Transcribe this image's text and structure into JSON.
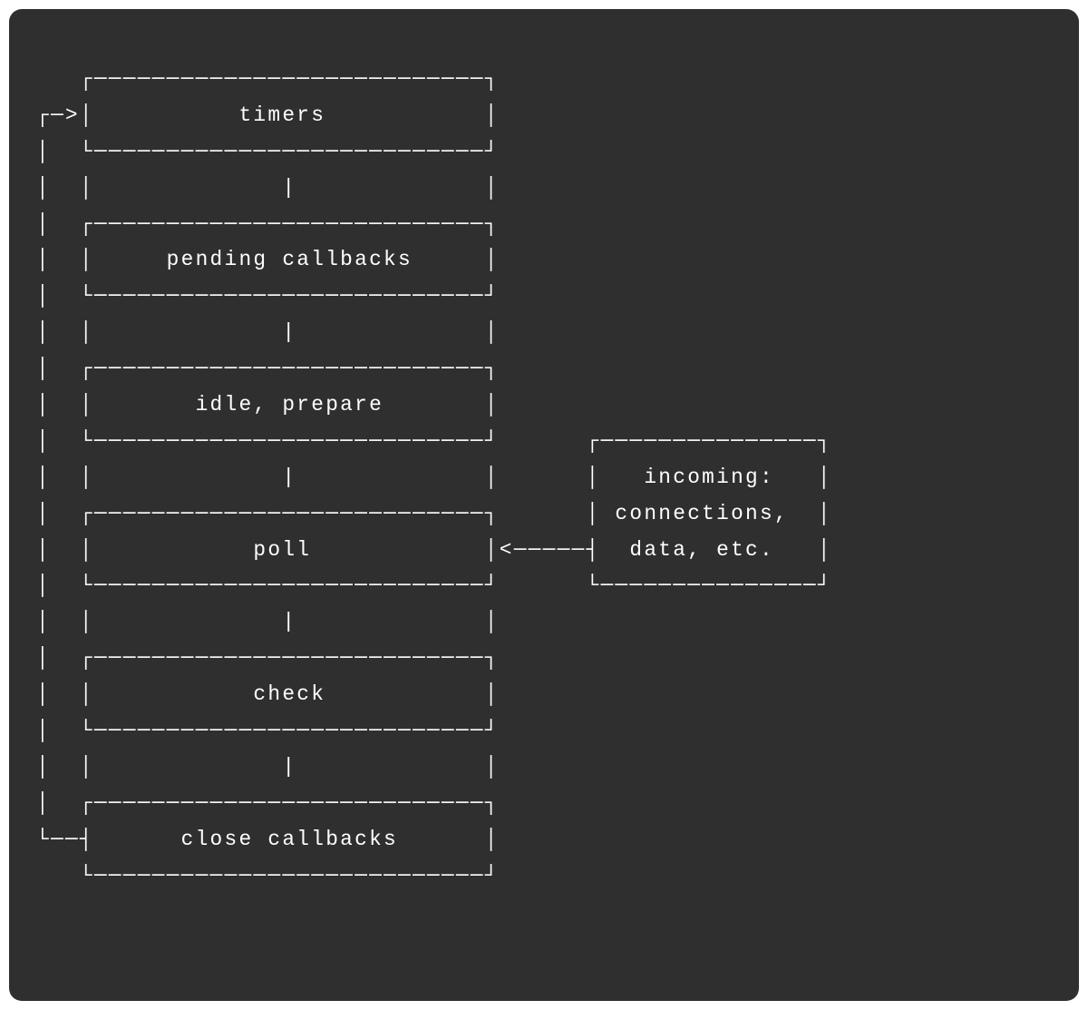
{
  "diagram": {
    "phases": [
      {
        "label": "timers"
      },
      {
        "label": "pending callbacks"
      },
      {
        "label": "idle, prepare"
      },
      {
        "label": "poll"
      },
      {
        "label": "check"
      },
      {
        "label": "close callbacks"
      }
    ],
    "incoming_box": {
      "lines": [
        "incoming:",
        "connections,",
        "data, etc."
      ]
    }
  },
  "colors": {
    "background": "#2f2f2f",
    "foreground": "#ffffff"
  }
}
